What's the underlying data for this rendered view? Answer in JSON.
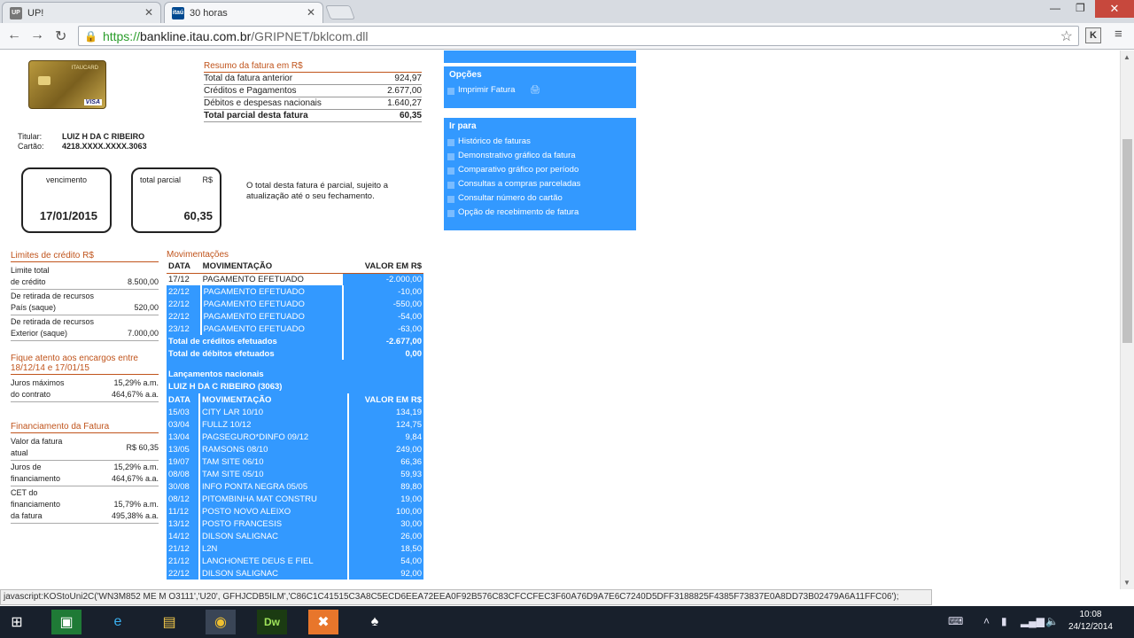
{
  "browser": {
    "tabs": [
      {
        "label": "UP!",
        "favicon": "UP",
        "active": false
      },
      {
        "label": "30 horas",
        "favicon": "itaú",
        "active": true
      }
    ],
    "url_scheme": "https://",
    "url_host": "bankline.itau.com.br",
    "url_path": "/GRIPNET/bklcom.dll",
    "status_text": "javascript:KOStoUni2C('WN3M852  ME M O3111','U20', GFHJCDB5ILM','C86C1C41515C3A8C5ECD6EEA72EEA0F92B576C83CFCCFEC3F60A76D9A7E6C7240D5DFF3188825F4385F73837E0A8DD73B02479A6A11FFC06');"
  },
  "card": {
    "brand": "ITAUCARD",
    "network": "VISA"
  },
  "summary": {
    "title": "Resumo da fatura em R$",
    "rows": [
      {
        "label": "Total da fatura anterior",
        "value": "924,97"
      },
      {
        "label": "Créditos e Pagamentos",
        "value": "2.677,00"
      },
      {
        "label": "Débitos e despesas nacionais",
        "value": "1.640,27"
      },
      {
        "label": "Total parcial desta fatura",
        "value": "60,35"
      }
    ]
  },
  "holder": {
    "titular_label": "Titular:",
    "titular": "LUIZ H DA C RIBEIRO",
    "cartao_label": "Cartão:",
    "cartao": "4218.XXXX.XXXX.3063"
  },
  "due": {
    "label": "vencimento",
    "date": "17/01/2015"
  },
  "partial": {
    "label": "total parcial",
    "currency": "R$",
    "value": "60,35"
  },
  "note": "O total desta fatura é parcial, sujeito a atualização até o seu fechamento.",
  "limits": {
    "title": "Limites de crédito R$",
    "rows": [
      {
        "label_a": "Limite total",
        "label_b": "de crédito",
        "value": "8.500,00"
      },
      {
        "label_a": "De retirada de recursos",
        "label_b": "País (saque)",
        "value": "520,00"
      },
      {
        "label_a": "De retirada de recursos",
        "label_b": "Exterior (saque)",
        "value": "7.000,00"
      }
    ]
  },
  "charges": {
    "title": "Fique atento aos encargos entre 18/12/14 e 17/01/15",
    "rows": [
      {
        "label_a": "Juros máximos",
        "label_b": "do contrato",
        "value_a": "15,29% a.m.",
        "value_b": "464,67% a.a."
      }
    ]
  },
  "financing": {
    "title": "Financiamento da Fatura",
    "rows": [
      {
        "label_a": "Valor da fatura",
        "label_b": "atual",
        "label_c": "",
        "value_a": "R$ 60,35",
        "value_b": ""
      },
      {
        "label_a": "Juros de",
        "label_b": "financiamento",
        "label_c": "",
        "value_a": "15,29% a.m.",
        "value_b": "464,67% a.a."
      },
      {
        "label_a": "CET do",
        "label_b": "financiamento",
        "label_c": "da fatura",
        "value_a": "15,79% a.m.",
        "value_b": "495,38% a.a."
      }
    ]
  },
  "movements": {
    "title": "Movimentações",
    "headers": {
      "date": "DATA",
      "desc": "MOVIMENTAÇÃO",
      "value": "VALOR EM R$"
    },
    "rows": [
      {
        "date": "17/12",
        "desc": "PAGAMENTO EFETUADO",
        "value": "-2.000,00"
      },
      {
        "date": "22/12",
        "desc": "PAGAMENTO EFETUADO",
        "value": "-10,00"
      },
      {
        "date": "22/12",
        "desc": "PAGAMENTO EFETUADO",
        "value": "-550,00"
      },
      {
        "date": "22/12",
        "desc": "PAGAMENTO EFETUADO",
        "value": "-54,00"
      },
      {
        "date": "23/12",
        "desc": "PAGAMENTO EFETUADO",
        "value": "-63,00"
      }
    ],
    "total_credits_label": "Total de créditos efetuados",
    "total_credits": "-2.677,00",
    "total_debits_label": "Total de débitos efetuados",
    "total_debits": "0,00"
  },
  "national": {
    "title": "Lançamentos nacionais",
    "holder": "LUIZ H DA C RIBEIRO (3063)",
    "headers": {
      "date": "DATA",
      "desc": "MOVIMENTAÇÃO",
      "value": "VALOR EM R$"
    },
    "rows": [
      {
        "date": "15/03",
        "desc": "CITY LAR 10/10",
        "value": "134,19"
      },
      {
        "date": "03/04",
        "desc": "FULLZ 10/12",
        "value": "124,75"
      },
      {
        "date": "13/04",
        "desc": "PAGSEGURO*DINFO 09/12",
        "value": "9,84"
      },
      {
        "date": "13/05",
        "desc": "RAMSONS 08/10",
        "value": "249,00"
      },
      {
        "date": "19/07",
        "desc": "TAM SITE 06/10",
        "value": "66,36"
      },
      {
        "date": "08/08",
        "desc": "TAM SITE 05/10",
        "value": "59,93"
      },
      {
        "date": "30/08",
        "desc": "INFO PONTA NEGRA 05/05",
        "value": "89,80"
      },
      {
        "date": "08/12",
        "desc": "PITOMBINHA MAT CONSTRU",
        "value": "19,00"
      },
      {
        "date": "11/12",
        "desc": "POSTO NOVO ALEIXO",
        "value": "100,00"
      },
      {
        "date": "13/12",
        "desc": "POSTO FRANCESIS",
        "value": "30,00"
      },
      {
        "date": "14/12",
        "desc": "DILSON SALIGNAC",
        "value": "26,00"
      },
      {
        "date": "21/12",
        "desc": "L2N",
        "value": "18,50"
      },
      {
        "date": "21/12",
        "desc": "LANCHONETE DEUS E FIEL",
        "value": "54,00"
      },
      {
        "date": "22/12",
        "desc": "DILSON SALIGNAC",
        "value": "92,00"
      }
    ]
  },
  "options": {
    "title": "Opções",
    "print_label": "Imprimir Fatura"
  },
  "goto": {
    "title": "Ir para",
    "items": [
      "Histórico de faturas",
      "Demonstrativo gráfico da fatura",
      "Comparativo gráfico por período",
      "Consultas a compras parceladas",
      "Consultar número do cartão",
      "Opção de recebimento de fatura"
    ]
  },
  "taskbar": {
    "time": "10:08",
    "date": "24/12/2014"
  }
}
